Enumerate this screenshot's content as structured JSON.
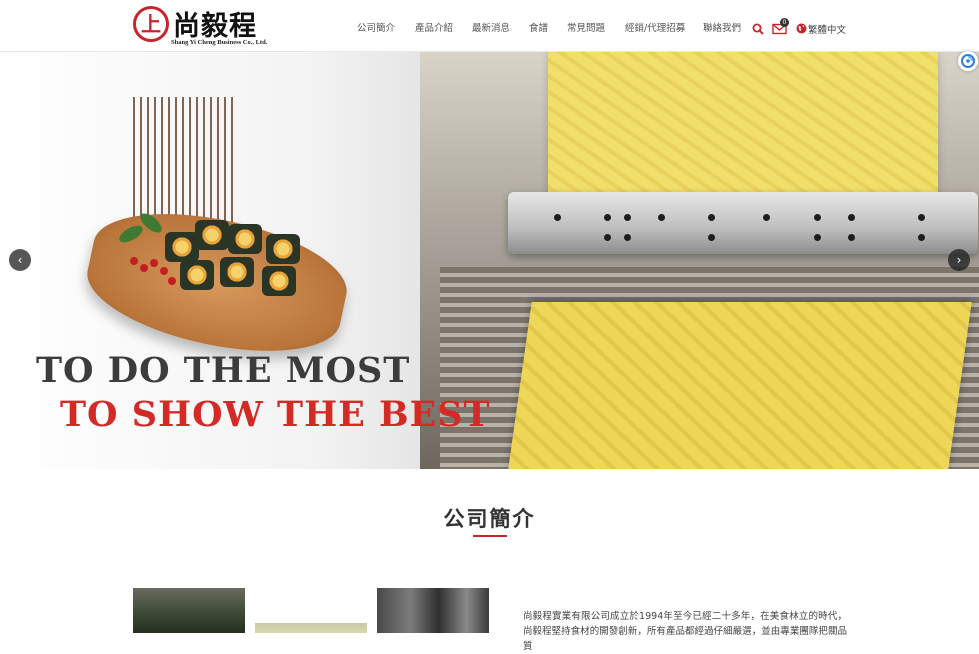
{
  "brand": {
    "logo_mark": "上",
    "name": "尚毅程",
    "subtitle": "Shang Yi Cheng Business Co., Ltd."
  },
  "nav": {
    "items": [
      "公司簡介",
      "產品介紹",
      "最新消息",
      "食譜",
      "常見問題",
      "經銷/代理招募",
      "聯絡我們"
    ],
    "mail_count": "0",
    "language": "繁體中文"
  },
  "banner": {
    "slogan_line1": "TO DO THE MOST",
    "slogan_line2": "TO SHOW THE BEST",
    "prev_label": "‹",
    "next_label": "›"
  },
  "about": {
    "title": "公司簡介",
    "text": "尚毅程實業有限公司成立於1994年至今已經二十多年，在美食林立的時代，尚毅程堅持食材的開發創新，所有產品都經過仔細嚴選，並由專業團隊把關品質"
  },
  "colors": {
    "accent": "#c9242b",
    "slogan_dark": "#3c3c3c",
    "slogan_red": "#d42a26"
  },
  "icons": [
    "search-icon",
    "mail-icon",
    "globe-icon",
    "chevron-left-icon",
    "chevron-right-icon"
  ]
}
